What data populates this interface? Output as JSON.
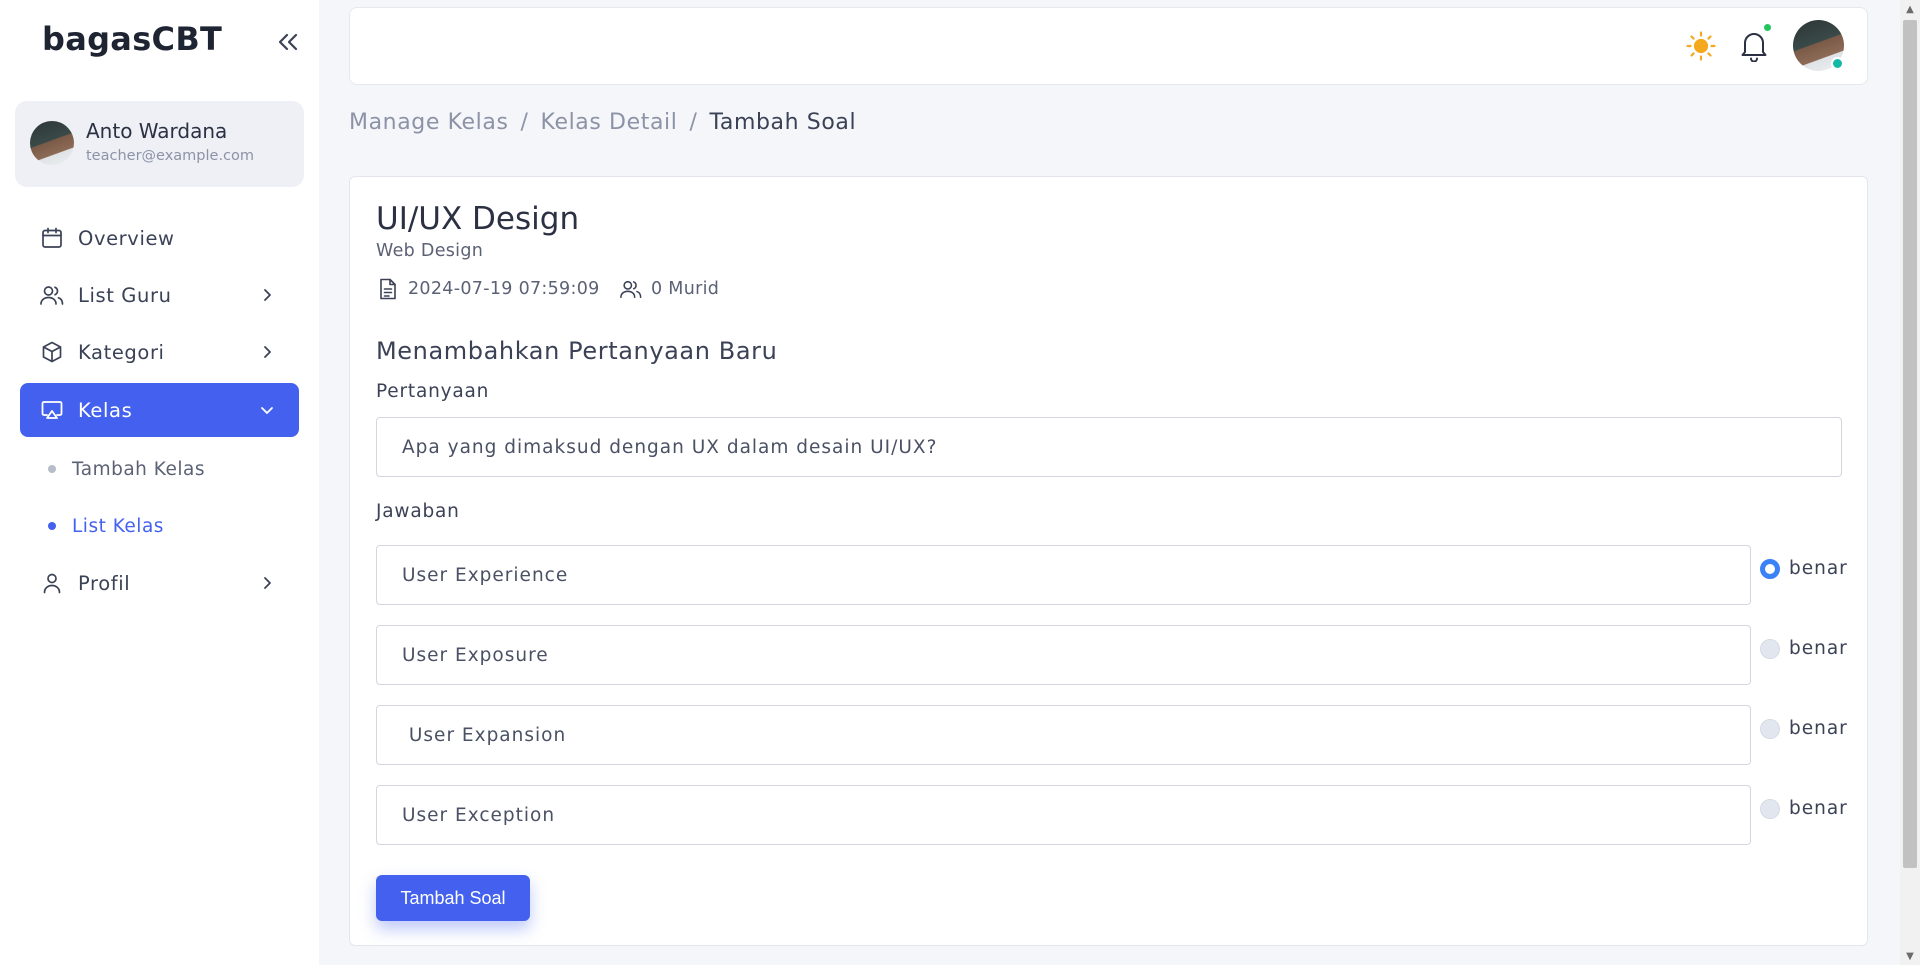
{
  "sidebar": {
    "brand": "bagasCBT",
    "user": {
      "name": "Anto Wardana",
      "email": "teacher@example.com"
    },
    "items": [
      {
        "label": "Overview",
        "icon": "calendar-icon",
        "active": false
      },
      {
        "label": "List Guru",
        "icon": "users-icon",
        "active": false
      },
      {
        "label": "Kategori",
        "icon": "box-icon",
        "active": false
      },
      {
        "label": "Kelas",
        "icon": "presentation-icon",
        "active": true
      },
      {
        "label": "Profil",
        "icon": "user-icon",
        "active": false
      }
    ],
    "sub_items": [
      {
        "label": "Tambah Kelas",
        "active": false
      },
      {
        "label": "List Kelas",
        "active": true
      }
    ]
  },
  "topbar": {
    "icons": [
      "sun-icon",
      "bell-icon",
      "avatar"
    ]
  },
  "breadcrumb": [
    "Manage Kelas",
    "Kelas Detail",
    "Tambah Soal"
  ],
  "course": {
    "title": "UI/UX Design",
    "category": "Web Design",
    "date": "2024-07-19 07:59:09",
    "students": "0 Murid"
  },
  "form": {
    "section_title": "Menambahkan Pertanyaan Baru",
    "question_label": "Pertanyaan",
    "question_value": "Apa yang dimaksud dengan UX dalam desain UI/UX?",
    "answers_label": "Jawaban",
    "answers": [
      {
        "value": "User Experience",
        "radio_label": "benar",
        "correct": true
      },
      {
        "value": "User Exposure",
        "radio_label": "benar",
        "correct": false
      },
      {
        "value": " User Expansion",
        "radio_label": "benar",
        "correct": false
      },
      {
        "value": "User Exception",
        "radio_label": "benar",
        "correct": false
      }
    ],
    "submit_label": "Tambah Soal"
  },
  "colors": {
    "primary": "#4361ee",
    "radio_checked": "#3b82f6",
    "accent_sun": "#f4a81d"
  }
}
